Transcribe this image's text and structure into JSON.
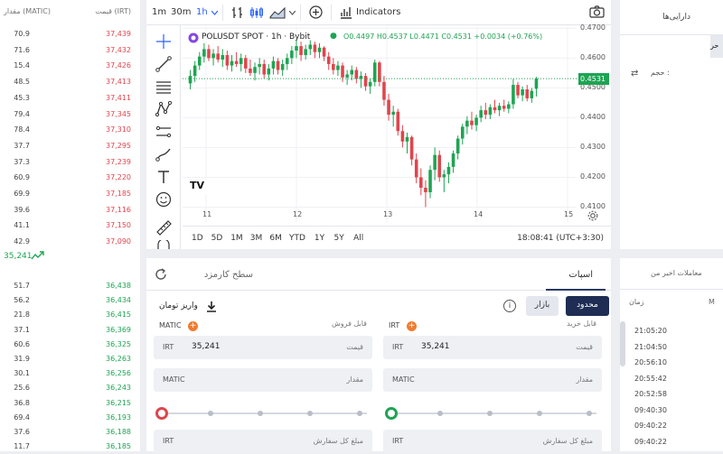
{
  "orderbook": {
    "headers": {
      "amount": "مقدار (MATIC)",
      "price": "قیمت (IRT)"
    },
    "asks": [
      {
        "amount": "70.9",
        "price": "37,439"
      },
      {
        "amount": "71.6",
        "price": "37,432"
      },
      {
        "amount": "15.4",
        "price": "37,426"
      },
      {
        "amount": "48.5",
        "price": "37,413"
      },
      {
        "amount": "45.3",
        "price": "37,411"
      },
      {
        "amount": "79.4",
        "price": "37,345"
      },
      {
        "amount": "78.4",
        "price": "37,310"
      },
      {
        "amount": "37.7",
        "price": "37,295"
      },
      {
        "amount": "37.3",
        "price": "37,239"
      },
      {
        "amount": "60.9",
        "price": "37,220"
      },
      {
        "amount": "69.9",
        "price": "37,185"
      },
      {
        "amount": "39.6",
        "price": "37,116"
      },
      {
        "amount": "41.1",
        "price": "37,150"
      },
      {
        "amount": "42.9",
        "price": "37,090"
      }
    ],
    "mid_price": "35,241",
    "bids": [
      {
        "amount": "51.7",
        "price": "36,438"
      },
      {
        "amount": "56.2",
        "price": "36,434"
      },
      {
        "amount": "21.8",
        "price": "36,415"
      },
      {
        "amount": "37.1",
        "price": "36,369"
      },
      {
        "amount": "60.6",
        "price": "36,325"
      },
      {
        "amount": "31.9",
        "price": "36,263"
      },
      {
        "amount": "30.1",
        "price": "36,256"
      },
      {
        "amount": "25.6",
        "price": "36,243"
      },
      {
        "amount": "36.8",
        "price": "36,215"
      },
      {
        "amount": "69.4",
        "price": "36,193"
      },
      {
        "amount": "37.6",
        "price": "36,188"
      },
      {
        "amount": "11.7",
        "price": "36,185"
      }
    ]
  },
  "chart": {
    "intervals": [
      "1m",
      "30m",
      "1h"
    ],
    "active_interval": "1h",
    "indicators_label": "Indicators",
    "symbol_line": "POLUSDT SPOT · 1h · Bybit",
    "ohlc": "O0.4497 H0.4537 L0.4471 C0.4531 +0.0034 (+0.76%)",
    "last_price": "0.4531",
    "price_ticks": [
      "0.4700",
      "0.4600",
      "0.4500",
      "0.4400",
      "0.4300",
      "0.4200",
      "0.4100"
    ],
    "time_ticks": [
      "11",
      "12",
      "13",
      "14",
      "15"
    ],
    "ranges": [
      "1D",
      "5D",
      "1M",
      "3M",
      "6M",
      "YTD",
      "1Y",
      "5Y",
      "All"
    ],
    "clock": "18:08:41 (UTC+3:30)",
    "logo_text": "TV",
    "colors": {
      "up": "#1ea453",
      "down": "#e0454d",
      "accent": "#2962ff"
    }
  },
  "chart_data": {
    "type": "candlestick",
    "x": [
      "11",
      "12",
      "13",
      "14",
      "15"
    ],
    "ylim": [
      0.405,
      0.471
    ],
    "candles": [
      [
        0.4515,
        0.456,
        0.4495,
        0.454
      ],
      [
        0.454,
        0.459,
        0.452,
        0.4575
      ],
      [
        0.4575,
        0.462,
        0.456,
        0.4605
      ],
      [
        0.4605,
        0.465,
        0.4585,
        0.463
      ],
      [
        0.463,
        0.4645,
        0.459,
        0.46
      ],
      [
        0.46,
        0.463,
        0.4575,
        0.4615
      ],
      [
        0.4615,
        0.464,
        0.4585,
        0.4595
      ],
      [
        0.4595,
        0.463,
        0.457,
        0.461
      ],
      [
        0.461,
        0.4625,
        0.456,
        0.4575
      ],
      [
        0.4575,
        0.461,
        0.4555,
        0.459
      ],
      [
        0.459,
        0.462,
        0.457,
        0.458
      ],
      [
        0.458,
        0.4615,
        0.4555,
        0.46
      ],
      [
        0.46,
        0.461,
        0.455,
        0.4565
      ],
      [
        0.4565,
        0.4595,
        0.454,
        0.455
      ],
      [
        0.455,
        0.4585,
        0.4525,
        0.457
      ],
      [
        0.457,
        0.46,
        0.4545,
        0.458
      ],
      [
        0.458,
        0.4595,
        0.453,
        0.4545
      ],
      [
        0.4545,
        0.458,
        0.4525,
        0.4565
      ],
      [
        0.4565,
        0.4605,
        0.4545,
        0.459
      ],
      [
        0.459,
        0.46,
        0.4545,
        0.456
      ],
      [
        0.456,
        0.4595,
        0.454,
        0.458
      ],
      [
        0.458,
        0.4615,
        0.456,
        0.46
      ],
      [
        0.46,
        0.464,
        0.458,
        0.4625
      ],
      [
        0.4625,
        0.466,
        0.46,
        0.464
      ],
      [
        0.464,
        0.4655,
        0.459,
        0.461
      ],
      [
        0.461,
        0.4645,
        0.4595,
        0.463
      ],
      [
        0.463,
        0.466,
        0.461,
        0.4645
      ],
      [
        0.4645,
        0.4655,
        0.46,
        0.462
      ],
      [
        0.462,
        0.465,
        0.46,
        0.4635
      ],
      [
        0.4635,
        0.464,
        0.459,
        0.4605
      ],
      [
        0.4605,
        0.462,
        0.456,
        0.458
      ],
      [
        0.458,
        0.46,
        0.4545,
        0.456
      ],
      [
        0.456,
        0.459,
        0.454,
        0.4575
      ],
      [
        0.4575,
        0.4585,
        0.452,
        0.4535
      ],
      [
        0.4535,
        0.456,
        0.451,
        0.4545
      ],
      [
        0.4545,
        0.4575,
        0.4525,
        0.456
      ],
      [
        0.456,
        0.457,
        0.4515,
        0.453
      ],
      [
        0.453,
        0.4555,
        0.45,
        0.454
      ],
      [
        0.454,
        0.455,
        0.449,
        0.4505
      ],
      [
        0.4505,
        0.453,
        0.448,
        0.452
      ],
      [
        0.452,
        0.4595,
        0.4505,
        0.4585
      ],
      [
        0.4585,
        0.459,
        0.4505,
        0.452
      ],
      [
        0.452,
        0.454,
        0.444,
        0.446
      ],
      [
        0.446,
        0.448,
        0.439,
        0.441
      ],
      [
        0.441,
        0.444,
        0.437,
        0.442
      ],
      [
        0.442,
        0.443,
        0.434,
        0.4355
      ],
      [
        0.4355,
        0.4375,
        0.43,
        0.432
      ],
      [
        0.432,
        0.435,
        0.428,
        0.4335
      ],
      [
        0.4335,
        0.434,
        0.424,
        0.426
      ],
      [
        0.426,
        0.428,
        0.418,
        0.42
      ],
      [
        0.42,
        0.423,
        0.414,
        0.4165
      ],
      [
        0.4165,
        0.419,
        0.41,
        0.415
      ],
      [
        0.415,
        0.424,
        0.413,
        0.4225
      ],
      [
        0.4225,
        0.43,
        0.419,
        0.4275
      ],
      [
        0.4275,
        0.429,
        0.4185,
        0.42
      ],
      [
        0.42,
        0.4225,
        0.415,
        0.421
      ],
      [
        0.421,
        0.425,
        0.418,
        0.4235
      ],
      [
        0.4235,
        0.429,
        0.4215,
        0.428
      ],
      [
        0.428,
        0.434,
        0.426,
        0.433
      ],
      [
        0.433,
        0.438,
        0.431,
        0.437
      ],
      [
        0.437,
        0.4405,
        0.4345,
        0.439
      ],
      [
        0.439,
        0.442,
        0.436,
        0.4375
      ],
      [
        0.4375,
        0.441,
        0.4355,
        0.44
      ],
      [
        0.44,
        0.444,
        0.4385,
        0.4425
      ],
      [
        0.4425,
        0.445,
        0.4395,
        0.441
      ],
      [
        0.441,
        0.4445,
        0.4395,
        0.4435
      ],
      [
        0.4435,
        0.446,
        0.4415,
        0.4425
      ],
      [
        0.4425,
        0.445,
        0.4405,
        0.444
      ],
      [
        0.444,
        0.446,
        0.442,
        0.443
      ],
      [
        0.443,
        0.4455,
        0.4415,
        0.4445
      ],
      [
        0.4445,
        0.453,
        0.443,
        0.451
      ],
      [
        0.451,
        0.452,
        0.4465,
        0.4475
      ],
      [
        0.4475,
        0.4505,
        0.4455,
        0.4495
      ],
      [
        0.4495,
        0.451,
        0.4455,
        0.4465
      ],
      [
        0.4465,
        0.45,
        0.445,
        0.449
      ],
      [
        0.4497,
        0.4537,
        0.4471,
        0.4531
      ]
    ]
  },
  "order_form": {
    "tab_spot": "اسپات",
    "tab_fee": "سطح کارمزد",
    "btn_limit": "محدود",
    "btn_market": "بازار",
    "info": "i",
    "deposit": "واریز تومان",
    "buy_label": "قابل خرید",
    "sell_label": "قابل فروش",
    "buy_coin": "IRT",
    "sell_coin": "MATIC",
    "plus": "+",
    "price_label": "قیمت",
    "amount_label": "مقدار",
    "total_label": "مبلغ کل سفارش",
    "price_currency": "IRT",
    "price_value": "35,241",
    "amount_currency": "MATIC",
    "total_currency": "IRT",
    "buy_slider": 0,
    "sell_slider": 0,
    "buy_color": "#1ea453",
    "sell_color": "#e0454d"
  },
  "right_panel": {
    "assets_title": "دارایی‌ها",
    "strip_text": "حر",
    "swap_icon": "⇄",
    "volume_label": "حجم :"
  },
  "trades": {
    "title": "معاملات اخیر من",
    "th_time": "زمان",
    "th_vol": "M",
    "rows": [
      "21:05:20",
      "21:04:50",
      "20:56:10",
      "20:55:42",
      "20:52:58",
      "09:40:30",
      "09:40:22",
      "09:40:22"
    ]
  }
}
